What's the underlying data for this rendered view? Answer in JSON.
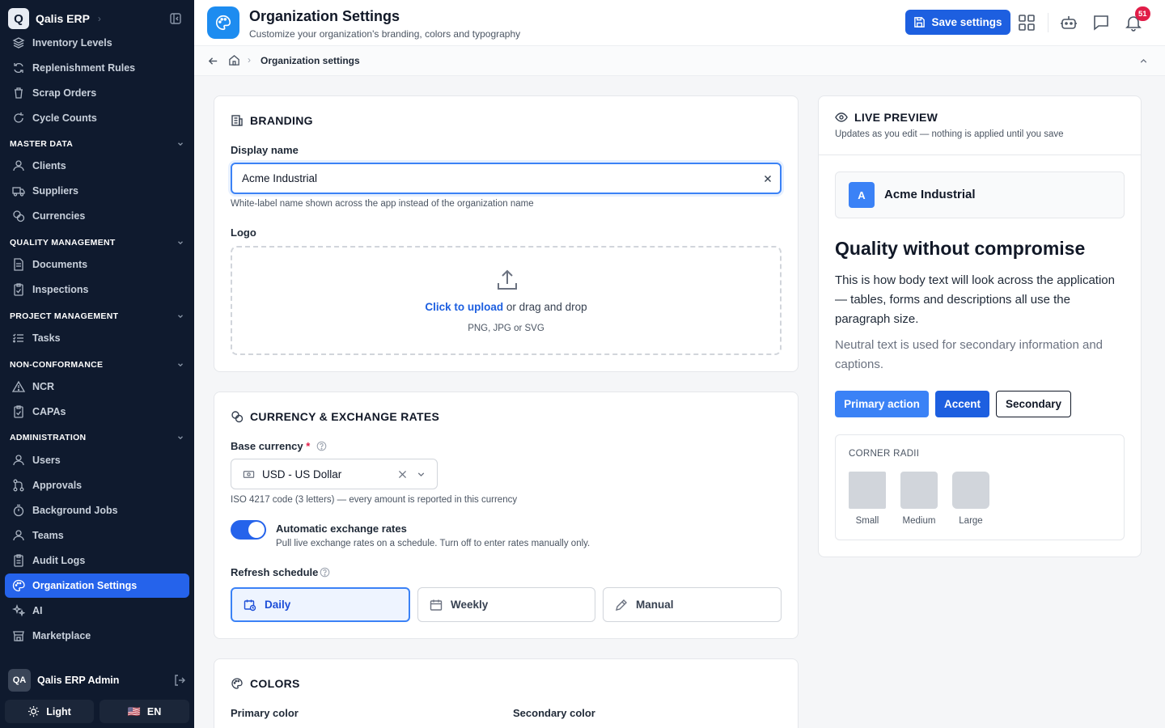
{
  "app": {
    "logo_letter": "Q",
    "name": "Qalis ERP"
  },
  "sidebar": {
    "items_top": [
      {
        "label": "Inventory Levels",
        "icon": "layers-icon"
      },
      {
        "label": "Replenishment Rules",
        "icon": "refresh-icon"
      },
      {
        "label": "Scrap Orders",
        "icon": "trash-icon"
      },
      {
        "label": "Cycle Counts",
        "icon": "cycle-icon"
      }
    ],
    "sections": [
      {
        "title": "MASTER DATA",
        "items": [
          "Clients",
          "Suppliers",
          "Currencies"
        ]
      },
      {
        "title": "QUALITY MANAGEMENT",
        "items": [
          "Documents",
          "Inspections"
        ]
      },
      {
        "title": "PROJECT MANAGEMENT",
        "items": [
          "Tasks"
        ]
      },
      {
        "title": "NON-CONFORMANCE",
        "items": [
          "NCR",
          "CAPAs"
        ]
      },
      {
        "title": "ADMINISTRATION",
        "items": [
          "Users",
          "Approvals",
          "Background Jobs",
          "Teams",
          "Audit Logs",
          "Organization Settings",
          "AI",
          "Marketplace"
        ]
      }
    ],
    "active_item": "Organization Settings",
    "user": {
      "initials": "QA",
      "name": "Qalis ERP Admin"
    },
    "theme_label": "Light",
    "lang_label": "EN",
    "lang_flag": "🇺🇸"
  },
  "header": {
    "title": "Organization Settings",
    "subtitle": "Customize your organization's branding, colors and typography",
    "save_label": "Save settings",
    "notification_count": "51"
  },
  "breadcrumb": {
    "current": "Organization settings"
  },
  "branding": {
    "title": "BRANDING",
    "display_name_label": "Display name",
    "display_name_value": "Acme Industrial",
    "display_name_help": "White-label name shown across the app instead of the organization name",
    "logo_label": "Logo",
    "upload_link": "Click to upload",
    "upload_rest": " or drag and drop",
    "upload_formats": "PNG, JPG or SVG"
  },
  "currency": {
    "title": "CURRENCY & EXCHANGE RATES",
    "base_label": "Base currency",
    "required_mark": "*",
    "base_value": "USD - US Dollar",
    "base_help": "ISO 4217 code (3 letters) — every amount is reported in this currency",
    "auto_label": "Automatic exchange rates",
    "auto_help": "Pull live exchange rates on a schedule. Turn off to enter rates manually only.",
    "auto_enabled": true,
    "schedule_label": "Refresh schedule",
    "schedule_options": [
      "Daily",
      "Weekly",
      "Manual"
    ],
    "schedule_selected": "Daily"
  },
  "colors": {
    "title": "COLORS",
    "primary_label": "Primary color",
    "secondary_label": "Secondary color"
  },
  "preview": {
    "title": "LIVE PREVIEW",
    "subtitle": "Updates as you edit — nothing is applied until you save",
    "brand_letter": "A",
    "brand_name": "Acme Industrial",
    "heading": "Quality without compromise",
    "body": "This is how body text will look across the application — tables, forms and descriptions all use the paragraph size.",
    "neutral": "Neutral text is used for secondary information and captions.",
    "btn_primary": "Primary action",
    "btn_accent": "Accent",
    "btn_secondary": "Secondary",
    "radii_title": "CORNER RADII",
    "radii": [
      "Small",
      "Medium",
      "Large"
    ]
  },
  "colors_palette": {
    "primary": "#2563eb",
    "accent": "#1d5fe0",
    "sidebar_bg": "#0f1a2e",
    "badge": "#e11d48"
  }
}
